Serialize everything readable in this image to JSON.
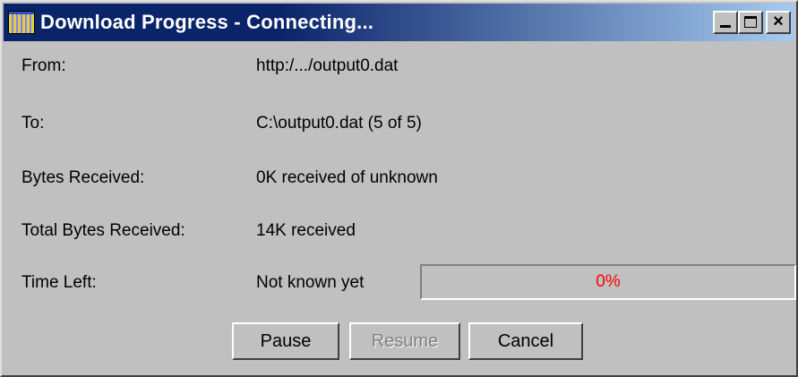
{
  "window": {
    "title": "Download Progress - Connecting...",
    "caption_buttons": {
      "minimize": "minimize-icon",
      "maximize": "maximize-icon",
      "close": "×"
    }
  },
  "rows": [
    {
      "label": "From:",
      "value": "http:/.../output0.dat"
    },
    {
      "label": "To:",
      "value": "C:\\output0.dat (5 of 5)"
    },
    {
      "label": "Bytes Received:",
      "value": "0K received of unknown"
    },
    {
      "label": "Total Bytes Received:",
      "value": "14K received"
    },
    {
      "label": "Time Left:",
      "value": "Not known yet"
    }
  ],
  "progress": {
    "percent": 0,
    "text": "0%"
  },
  "buttons": {
    "pause": "Pause",
    "resume": "Resume",
    "cancel": "Cancel"
  },
  "colors": {
    "title_bar": "#0a246a",
    "face": "#c0c0c0",
    "progress_text": "#ff0000"
  }
}
